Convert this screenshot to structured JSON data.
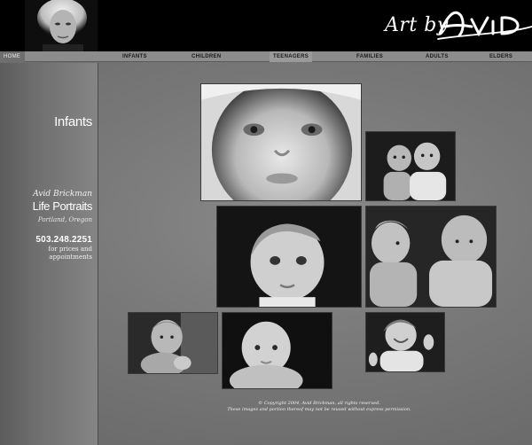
{
  "header": {
    "brand_prefix": "Art by",
    "brand_script": "Avid"
  },
  "nav": {
    "home": "HOME",
    "items": [
      "INFANTS",
      "CHILDREN",
      "TEENAGERS",
      "FAMILIES",
      "ADULTS",
      "ELDERS"
    ]
  },
  "sidebar": {
    "section_title": "Infants",
    "photographer": "Avid Brickman",
    "business": "Life Portraits",
    "location": "Portland, Oregon",
    "phone": "503.248.2251",
    "phone_note_1": "for prices and",
    "phone_note_2": "appointments"
  },
  "footer": {
    "line1": "© Copyright 2004, Avid Brickman, all rights reserved.",
    "line2": "These images and portion thereof may not be reused without express permission."
  },
  "colors": {
    "header_bg": "#000000",
    "nav_bg": "#8c8c8c",
    "page_bg": "#7a7a7a"
  }
}
